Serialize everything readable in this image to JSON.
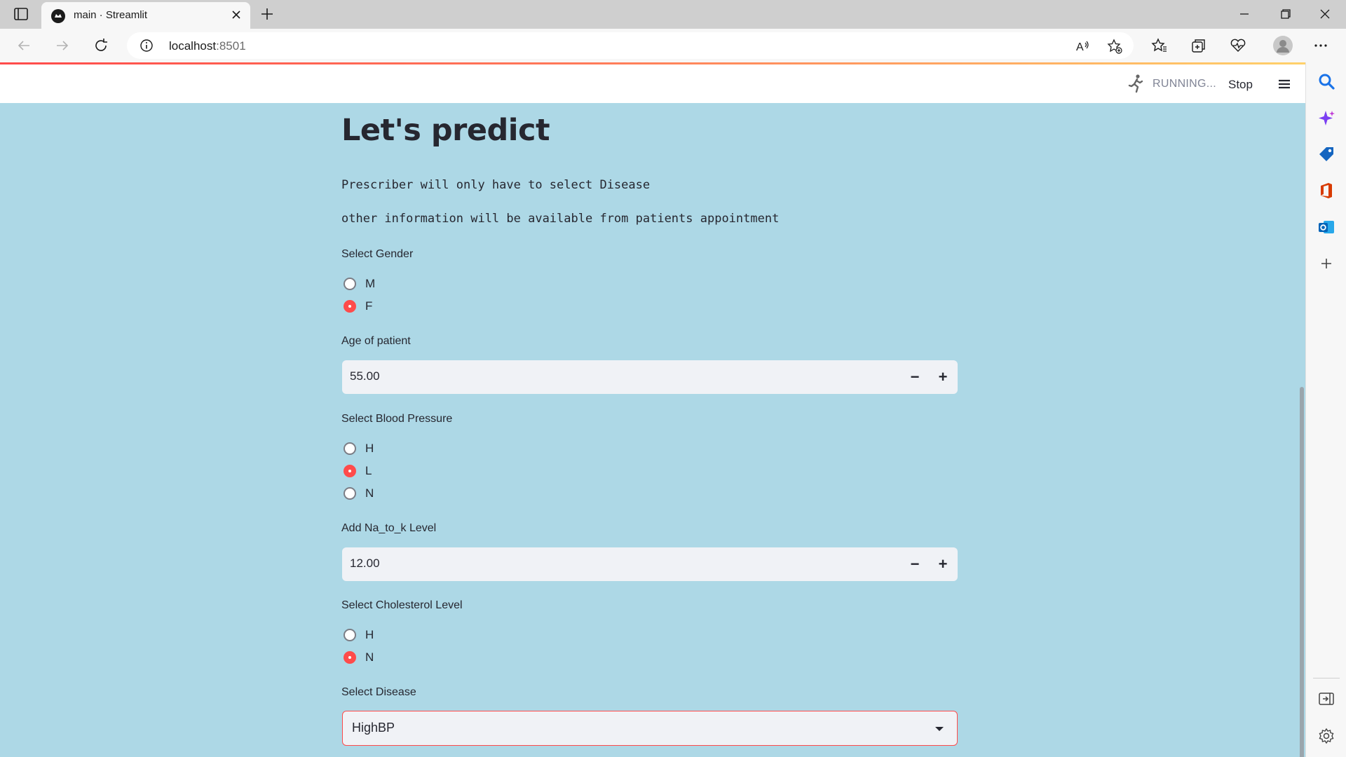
{
  "browser": {
    "tab_title": "main · Streamlit",
    "url_host": "localhost",
    "url_port": ":8501"
  },
  "header": {
    "status": "RUNNING...",
    "stop_label": "Stop"
  },
  "app": {
    "title": "Let's predict",
    "line1": "Prescriber will only have to select Disease",
    "line2": "other information will be available from patients appointment",
    "gender": {
      "label": "Select Gender",
      "options": [
        "M",
        "F"
      ],
      "selected": "F"
    },
    "age": {
      "label": "Age of patient",
      "value": "55.00",
      "minus": "−",
      "plus": "+"
    },
    "bp": {
      "label": "Select Blood Pressure",
      "options": [
        "H",
        "L",
        "N"
      ],
      "selected": "L"
    },
    "na_to_k": {
      "label": "Add Na_to_k Level",
      "value": "12.00",
      "minus": "−",
      "plus": "+"
    },
    "cholesterol": {
      "label": "Select Cholesterol Level",
      "options": [
        "H",
        "N"
      ],
      "selected": "N"
    },
    "disease": {
      "label": "Select Disease",
      "value": "HighBP"
    }
  },
  "colors": {
    "app_background": "#add8e6",
    "primary": "#ff4b4b",
    "input_background": "#f0f2f6"
  }
}
